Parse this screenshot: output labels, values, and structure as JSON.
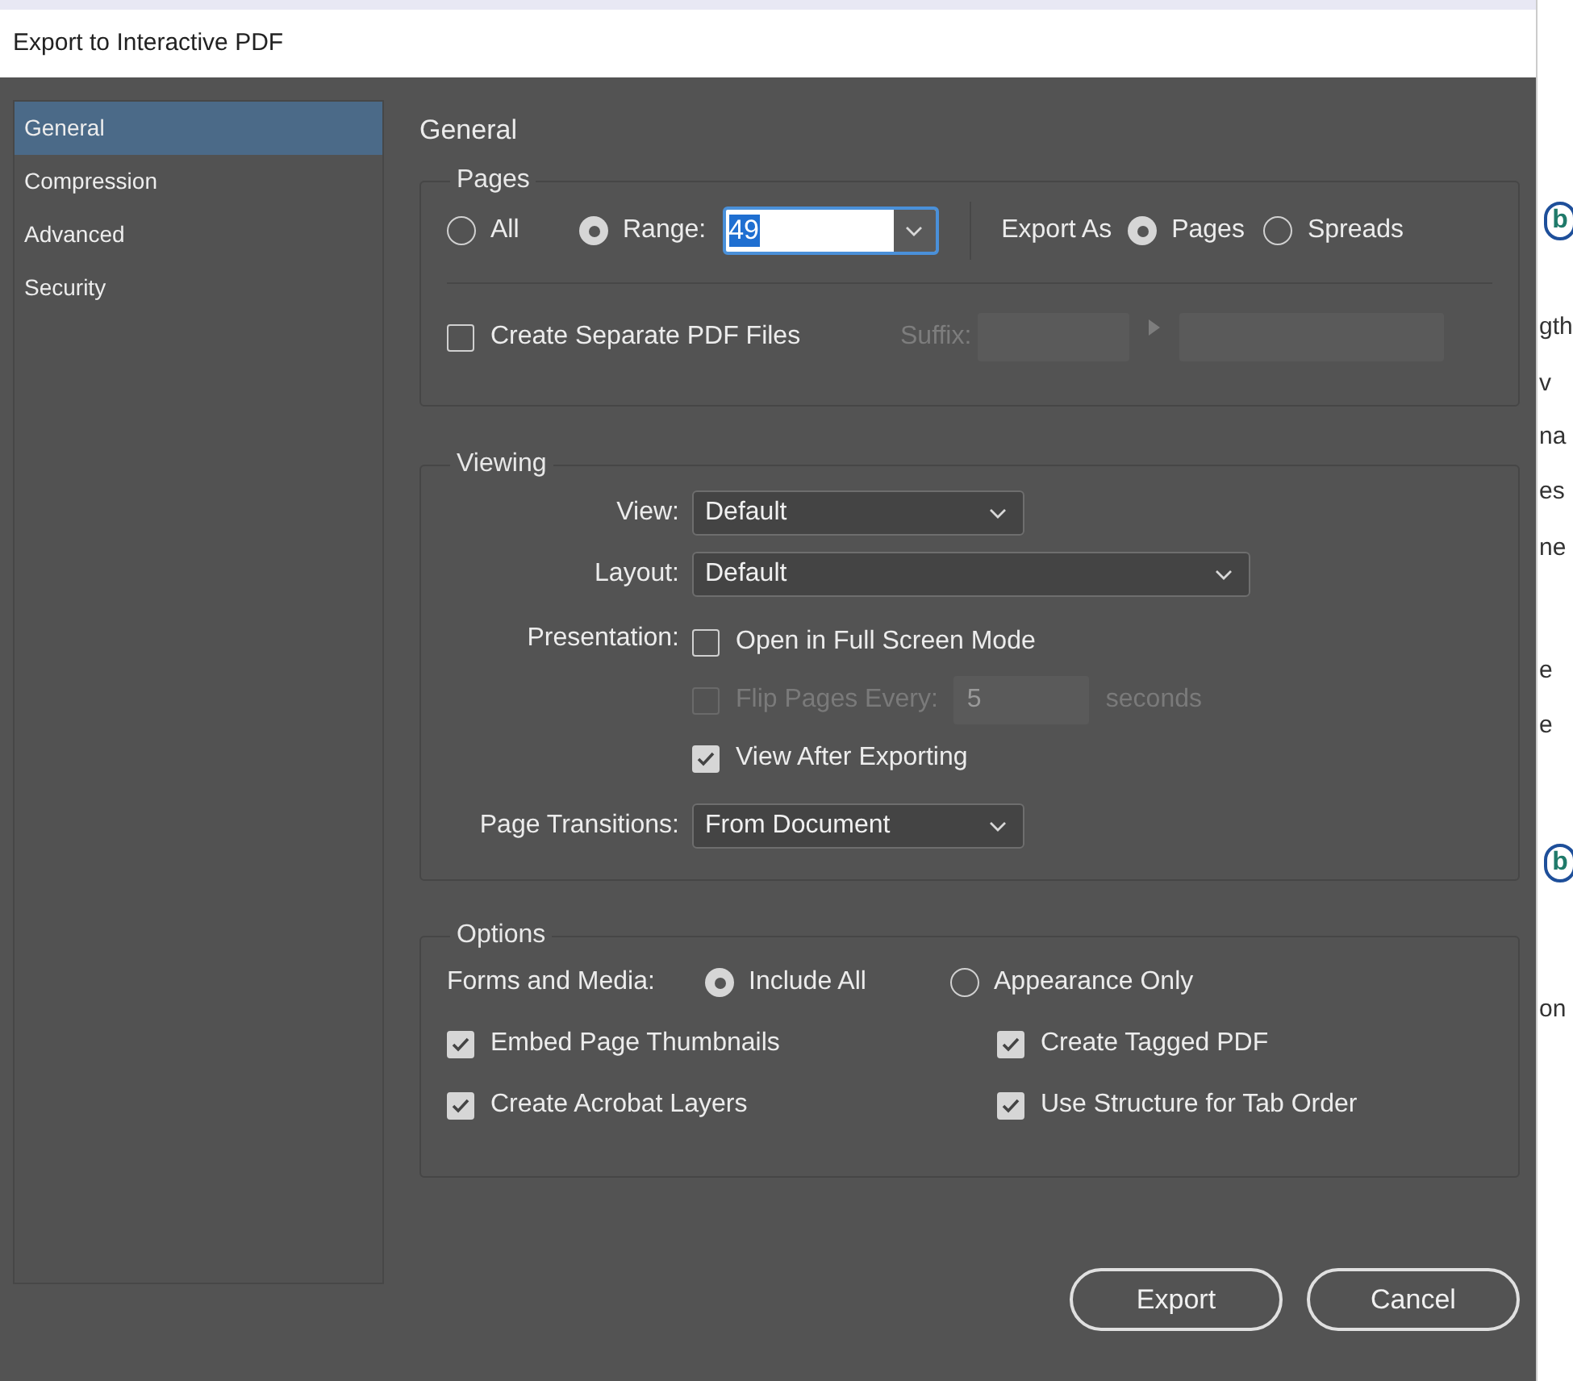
{
  "window": {
    "title": "Export to Interactive PDF"
  },
  "sidebar": {
    "items": [
      {
        "label": "General",
        "selected": true
      },
      {
        "label": "Compression",
        "selected": false
      },
      {
        "label": "Advanced",
        "selected": false
      },
      {
        "label": "Security",
        "selected": false
      }
    ]
  },
  "heading": "General",
  "pages": {
    "title": "Pages",
    "scope": [
      {
        "label": "All",
        "selected": false
      },
      {
        "label": "Range:",
        "selected": true
      }
    ],
    "range": {
      "value": "49"
    },
    "export_as": {
      "label": "Export As",
      "options": [
        {
          "label": "Pages",
          "selected": true
        },
        {
          "label": "Spreads",
          "selected": false
        }
      ]
    },
    "separate_files": {
      "label": "Create Separate PDF Files",
      "checked": false
    },
    "suffix": {
      "label": "Suffix:",
      "disabled": true
    }
  },
  "viewing": {
    "title": "Viewing",
    "view": {
      "label": "View:",
      "value": "Default"
    },
    "layout": {
      "label": "Layout:",
      "value": "Default"
    },
    "presentation_label": "Presentation:",
    "presentation": [
      {
        "kind": "checkbox",
        "label": "Open in Full Screen Mode",
        "checked": false,
        "disabled": false
      },
      {
        "kind": "timer",
        "label": "Flip Pages Every:",
        "value": "5",
        "unit": "seconds",
        "checked": false,
        "disabled": true
      },
      {
        "kind": "checkbox",
        "label": "View After Exporting",
        "checked": true,
        "disabled": false
      }
    ],
    "page_transitions": {
      "label": "Page Transitions:",
      "value": "From Document"
    }
  },
  "options": {
    "title": "Options",
    "forms_label": "Forms and Media:",
    "forms_media": [
      {
        "label": "Include All",
        "selected": true
      },
      {
        "label": "Appearance Only",
        "selected": false
      }
    ],
    "checkboxes": [
      {
        "label": "Embed Page Thumbnails",
        "checked": true
      },
      {
        "label": "Create Tagged PDF",
        "checked": true
      },
      {
        "label": "Create Acrobat Layers",
        "checked": true
      },
      {
        "label": "Use Structure for Tab Order",
        "checked": true
      }
    ]
  },
  "buttons": [
    "Export",
    "Cancel"
  ],
  "background_document": {
    "fragments": [
      {
        "kind": "badge",
        "text": "b"
      },
      {
        "kind": "text",
        "text": "gth"
      },
      {
        "kind": "text",
        "text": "v"
      },
      {
        "kind": "text",
        "text": "na"
      },
      {
        "kind": "text",
        "text": "es"
      },
      {
        "kind": "text",
        "text": "ne"
      },
      {
        "kind": "text",
        "text": "e"
      },
      {
        "kind": "text",
        "text": "e"
      },
      {
        "kind": "badge",
        "text": "b"
      },
      {
        "kind": "text",
        "text": "on"
      }
    ]
  }
}
